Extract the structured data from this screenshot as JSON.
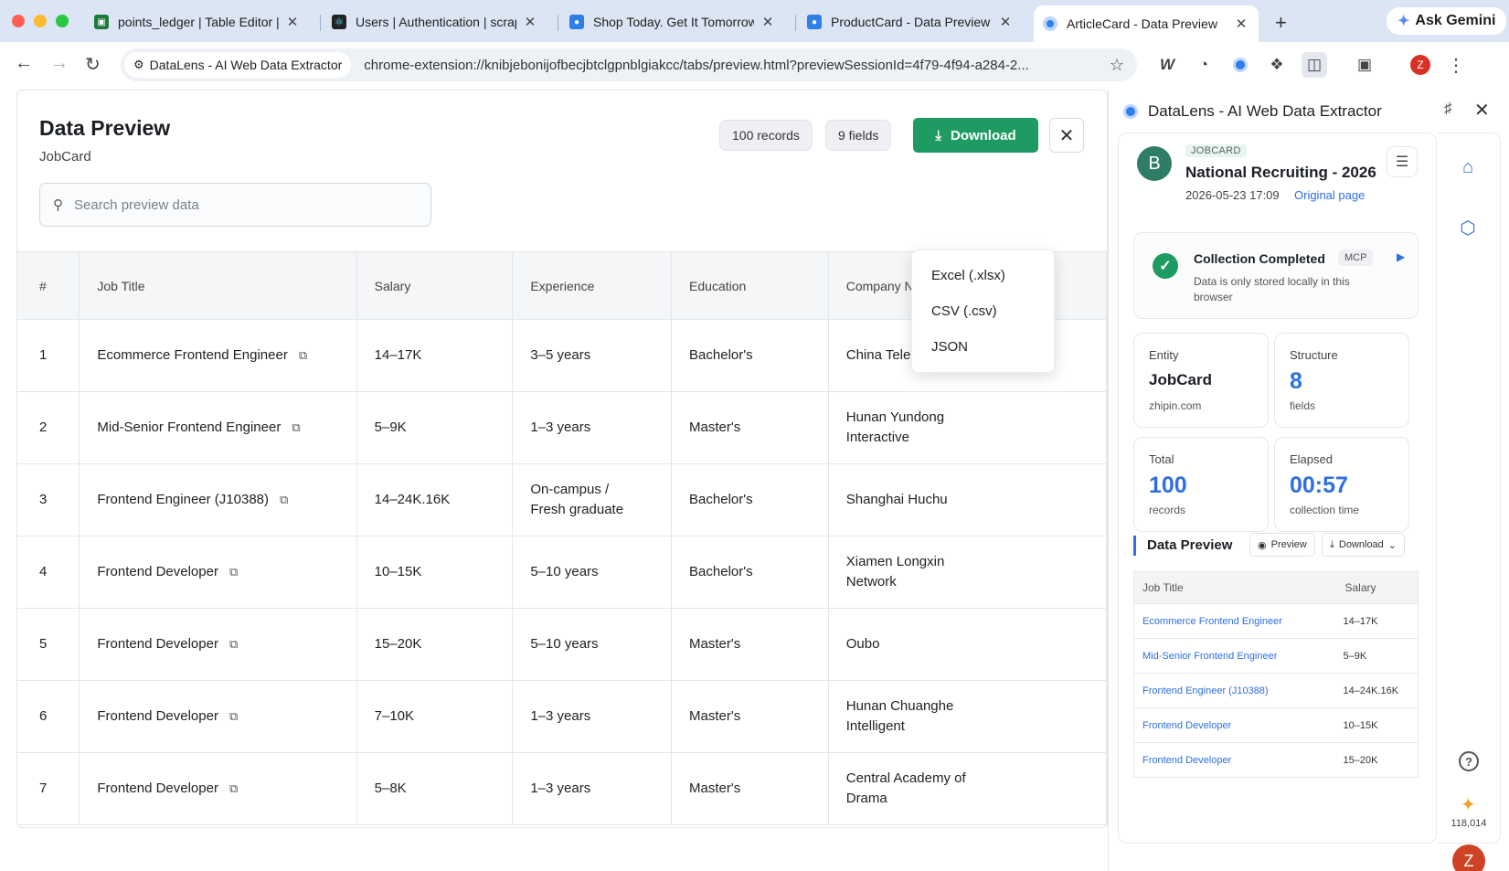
{
  "browser": {
    "tabs": [
      {
        "title": "points_ledger | Table Editor |",
        "active": false
      },
      {
        "title": "Users | Authentication | scrap",
        "active": false
      },
      {
        "title": "Shop Today. Get It Tomorrow",
        "active": false
      },
      {
        "title": "ProductCard - Data Preview",
        "active": false
      },
      {
        "title": "ArticleCard - Data Preview",
        "active": true
      }
    ],
    "gemini_label": "Ask Gemini",
    "site_chip": "DataLens - AI Web Data Extractor",
    "url": "chrome-extension://knibjebonijofbecjbtclgpnblgiakcc/tabs/preview.html?previewSessionId=4f79-4f94-a284-2...",
    "profile_initial": "Z"
  },
  "preview": {
    "title": "Data Preview",
    "subtitle": "JobCard",
    "records_chip": "100 records",
    "fields_chip": "9 fields",
    "download_label": "Download",
    "search_placeholder": "Search preview data",
    "dropdown": [
      "Excel (.xlsx)",
      "CSV (.csv)",
      "JSON"
    ],
    "columns": [
      "#",
      "Job Title",
      "Salary",
      "Experience",
      "Education",
      "Company Name"
    ],
    "rows": [
      [
        "1",
        "Ecommerce Frontend Engineer",
        "14–17K",
        "3–5 years",
        "Bachelor's",
        "China Telecom"
      ],
      [
        "2",
        "Mid-Senior Frontend Engineer",
        "5–9K",
        "1–3 years",
        "Master's",
        "Hunan Yundong Interactive"
      ],
      [
        "3",
        "Frontend Engineer (J10388)",
        "14–24K.16K",
        "On-campus / Fresh graduate",
        "Bachelor's",
        "Shanghai Huchu"
      ],
      [
        "4",
        "Frontend Developer",
        "10–15K",
        "5–10 years",
        "Bachelor's",
        "Xiamen Longxin Network"
      ],
      [
        "5",
        "Frontend Developer",
        "15–20K",
        "5–10 years",
        "Master's",
        "Oubo"
      ],
      [
        "6",
        "Frontend Developer",
        "7–10K",
        "1–3 years",
        "Master's",
        "Hunan Chuanghe Intelligent"
      ],
      [
        "7",
        "Frontend Developer",
        "5–8K",
        "1–3 years",
        "Master's",
        "Central Academy of Drama"
      ]
    ]
  },
  "side": {
    "header": "DataLens - AI Web Data Extractor",
    "record": {
      "avatar": "B",
      "tag": "JOBCARD",
      "title": "National Recruiting - 2026...",
      "date": "2026-05-23 17:09",
      "link": "Original page"
    },
    "status": {
      "title": "Collection Completed",
      "badge": "MCP",
      "desc": "Data is only stored locally in this browser"
    },
    "stats": {
      "entity_label": "Entity",
      "entity_value": "JobCard",
      "entity_sub": "zhipin.com",
      "structure_label": "Structure",
      "structure_value": "8",
      "structure_sub": "fields",
      "total_label": "Total",
      "total_value": "100",
      "total_sub": "records",
      "elapsed_label": "Elapsed",
      "elapsed_value": "00:57",
      "elapsed_sub": "collection time"
    },
    "data_preview": {
      "title": "Data Preview",
      "preview_btn": "Preview",
      "download_btn": "Download",
      "columns": [
        "Job Title",
        "Salary"
      ],
      "rows": [
        [
          "Ecommerce Frontend Engineer",
          "14–17K"
        ],
        [
          "Mid-Senior Frontend Engineer",
          "5–9K"
        ],
        [
          "Frontend Engineer (J10388)",
          "14–24K.16K"
        ],
        [
          "Frontend Developer",
          "10–15K"
        ],
        [
          "Frontend Developer",
          "15–20K"
        ]
      ]
    },
    "credits": "118,014",
    "user_initial": "Z"
  },
  "colors": {
    "accent": "#2d6fe0",
    "success": "#1e9a63"
  }
}
